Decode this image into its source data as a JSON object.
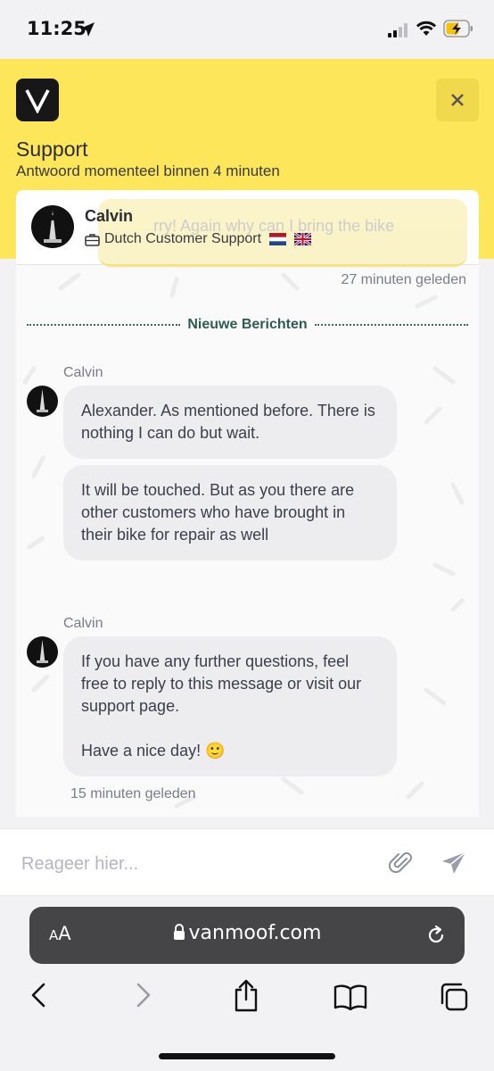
{
  "status_bar": {
    "time": "11:25",
    "icons": [
      "location-arrow-icon",
      "cellular-signal-icon",
      "wifi-icon",
      "battery-charging-icon"
    ]
  },
  "header": {
    "logo_letter": "V",
    "title": "Support",
    "subtitle": "Antwoord momenteel binnen 4 minuten",
    "background_color": "#fde65a"
  },
  "chat": {
    "agent": {
      "name": "Calvin",
      "role": "Dutch Customer Support",
      "flags": [
        "netherlands-flag",
        "uk-flag"
      ]
    },
    "ghost_message": "rry! Again why can I bring the bike",
    "first_timestamp": "27 minuten geleden",
    "divider_label": "Nieuwe Berichten",
    "groups": [
      {
        "sender": "Calvin",
        "messages": [
          {
            "paragraphs": [
              "Alexander. As mentioned before. There is nothing I can do but wait."
            ]
          },
          {
            "paragraphs": [
              "It will be touched. But as you there are other customers who have brought in their bike for repair as well"
            ]
          }
        ]
      },
      {
        "sender": "Calvin",
        "messages": [
          {
            "paragraphs": [
              "If you have any further questions, feel free to reply to this message or visit our support page.",
              "Have a nice day! 🙂"
            ]
          }
        ]
      }
    ],
    "last_timestamp": "15 minuten geleden"
  },
  "composer": {
    "placeholder": "Reageer hier...",
    "value": ""
  },
  "browser": {
    "aa_small": "A",
    "aa_big": "A",
    "url": "vanmoof.com"
  }
}
